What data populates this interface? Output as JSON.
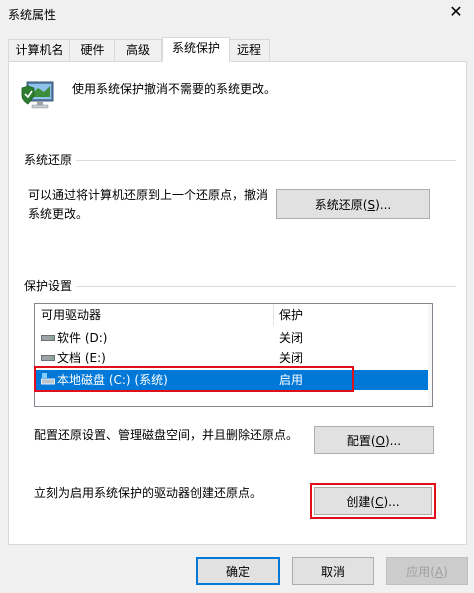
{
  "window": {
    "title": "系统属性"
  },
  "tabs": [
    {
      "label": "计算机名"
    },
    {
      "label": "硬件"
    },
    {
      "label": "高级"
    },
    {
      "label": "系统保护"
    },
    {
      "label": "远程"
    }
  ],
  "intro_text": "使用系统保护撤消不需要的系统更改。",
  "system_restore": {
    "group_label": "系统还原",
    "description": "可以通过将计算机还原到上一个还原点，撤消系统更改。",
    "button": {
      "text": "系统还原(",
      "key": "S",
      "suffix": ")..."
    }
  },
  "protection": {
    "group_label": "保护设置",
    "columns": [
      "可用驱动器",
      "保护"
    ],
    "rows": [
      {
        "name": "软件 (D:)",
        "status": "关闭",
        "selected": false
      },
      {
        "name": "文档 (E:)",
        "status": "关闭",
        "selected": false
      },
      {
        "name": "本地磁盘 (C:) (系统)",
        "status": "启用",
        "selected": true
      }
    ],
    "configure_text": "配置还原设置、管理磁盘空间，并且删除还原点。",
    "configure_button": {
      "text": "配置(",
      "key": "O",
      "suffix": ")..."
    },
    "create_text": "立刻为启用系统保护的驱动器创建还原点。",
    "create_button": {
      "text": "创建(",
      "key": "C",
      "suffix": ")..."
    }
  },
  "footer": {
    "ok": "确定",
    "cancel": "取消",
    "apply": {
      "text": "应用(",
      "key": "A",
      "suffix": ")"
    }
  },
  "colors": {
    "selection": "#0078d7",
    "highlight_box": "#e0101a"
  }
}
